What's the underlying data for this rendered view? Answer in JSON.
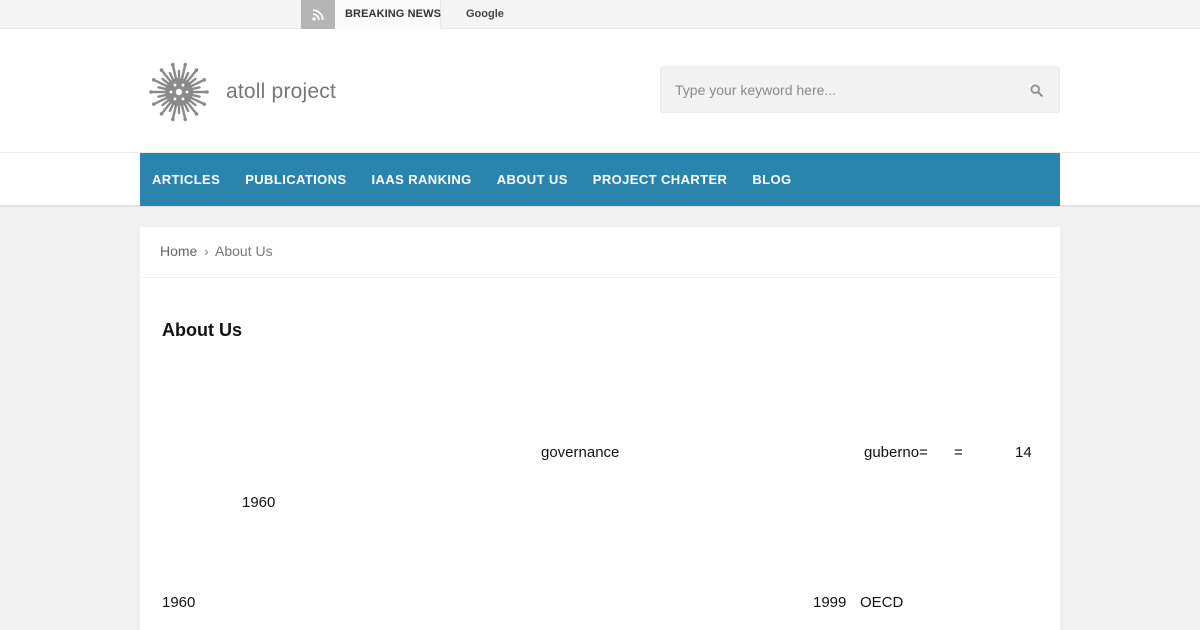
{
  "topbar": {
    "rss_icon": "rss-icon",
    "breaking_label": "BREAKING NEWS",
    "ticker_text": "Google"
  },
  "header": {
    "logo_icon": "atoll-logo-icon",
    "logo_text": "atoll project",
    "search": {
      "placeholder": "Type your keyword here...",
      "value": "",
      "icon": "search-icon"
    }
  },
  "nav": {
    "items": [
      {
        "label": "ARTICLES"
      },
      {
        "label": "PUBLICATIONS"
      },
      {
        "label": "IAAS RANKING"
      },
      {
        "label": "ABOUT US"
      },
      {
        "label": "PROJECT CHARTER"
      },
      {
        "label": "BLOG"
      }
    ],
    "color": "#2a84ab"
  },
  "breadcrumb": {
    "home": "Home",
    "separator": "›",
    "current": "About Us"
  },
  "page": {
    "title": "About Us",
    "fragments": [
      "governance",
      "guberno=",
      "=",
      "14",
      "1960",
      "1960",
      "1999",
      "OECD"
    ]
  }
}
